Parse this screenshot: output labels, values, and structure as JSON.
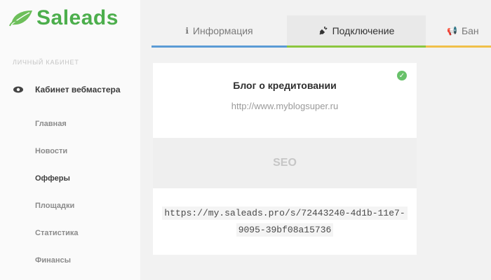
{
  "brand": {
    "name": "Saleads",
    "color": "#4cae4c"
  },
  "sidebar": {
    "section_label": "ЛИЧНЫЙ КАБИНЕТ",
    "cabinet_label": "Кабинет вебмастера",
    "cabinet_icon": "eye-icon",
    "items": [
      {
        "label": "Главная"
      },
      {
        "label": "Новости"
      },
      {
        "label": "Офферы",
        "active": true
      },
      {
        "label": "Площадки"
      },
      {
        "label": "Статистика"
      },
      {
        "label": "Финансы"
      }
    ]
  },
  "tabs": [
    {
      "label": "Информация",
      "icon": "info-icon",
      "accent": "#5b9bd5"
    },
    {
      "label": "Подключение",
      "icon": "plug-icon",
      "accent": "#8cc63f",
      "active": true
    },
    {
      "label": "Бан",
      "icon": "megaphone-icon",
      "accent": "#f0c04a"
    }
  ],
  "site": {
    "name": "Блог о кредитовании",
    "url": "http://www.myblogsuper.ru",
    "status": "verified",
    "status_color": "#68c16a"
  },
  "seo_label": "SEO",
  "ref_link": {
    "line1": "https://my.saleads.pro/s/72443240-4d1b-11e7-",
    "line2": "9095-39bf08a15736"
  }
}
